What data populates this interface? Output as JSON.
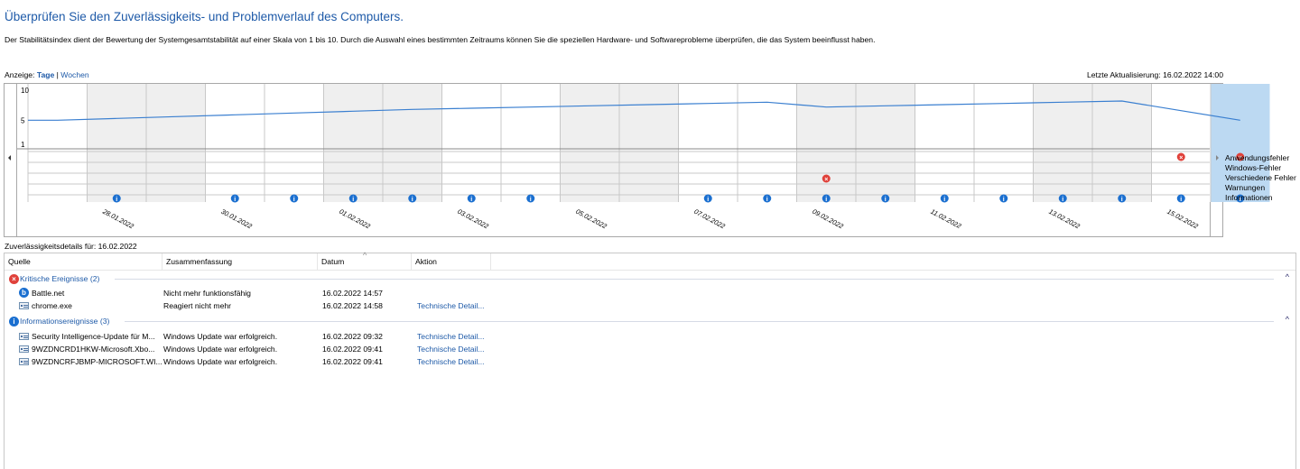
{
  "header": {
    "title": "Überprüfen Sie den Zuverlässigkeits- und Problemverlauf des Computers.",
    "description": "Der Stabilitätsindex dient der Bewertung der Systemgesamtstabilität auf einer Skala von 1 bis 10. Durch die Auswahl eines bestimmten Zeitraums können Sie die speziellen Hardware- und Softwareprobleme überprüfen, die das System beeinflusst haben.",
    "view_label": "Anzeige:",
    "view_days": "Tage",
    "view_sep": "|",
    "view_weeks": "Wochen",
    "last_update": "Letzte Aktualisierung: 16.02.2022 14:00"
  },
  "chart": {
    "y_ticks": [
      "10",
      "5",
      "1"
    ],
    "legend": [
      "Anwendungsfehler",
      "Windows-Fehler",
      "Verschiedene Fehler",
      "Warnungen",
      "Informationen"
    ],
    "date_labels": [
      "28.01.2022",
      "30.01.2022",
      "01.02.2022",
      "03.02.2022",
      "05.02.2022",
      "07.02.2022",
      "09.02.2022",
      "11.02.2022",
      "13.02.2022",
      "15.02.2022"
    ],
    "selected_day": "16.02.2022",
    "colors": {
      "line": "#3a7fd0",
      "selected": "#bcd9f2",
      "alt": "#efefef",
      "error": "#e0413a",
      "info": "#1a6fd0"
    },
    "chart_data": {
      "type": "line",
      "x": [
        "27.01.2022",
        "28.01.2022",
        "29.01.2022",
        "30.01.2022",
        "31.01.2022",
        "01.02.2022",
        "02.02.2022",
        "03.02.2022",
        "04.02.2022",
        "05.02.2022",
        "06.02.2022",
        "07.02.2022",
        "08.02.2022",
        "09.02.2022",
        "10.02.2022",
        "11.02.2022",
        "12.02.2022",
        "13.02.2022",
        "14.02.2022",
        "15.02.2022",
        "16.02.2022"
      ],
      "series": [
        {
          "values": [
            5.0,
            5.3,
            5.6,
            5.9,
            6.2,
            6.5,
            6.8,
            7.0,
            7.2,
            7.4,
            7.6,
            7.8,
            8.0,
            7.2,
            7.4,
            7.6,
            7.8,
            8.0,
            8.2,
            6.6,
            5.0
          ]
        }
      ],
      "ylim": [
        1,
        10
      ],
      "markers": {
        "Anwendungsfehler": [
          "15.02.2022",
          "16.02.2022"
        ],
        "Verschiedene Fehler": [
          "09.02.2022"
        ],
        "Informationen": [
          "28.01.2022",
          "30.01.2022",
          "31.01.2022",
          "01.02.2022",
          "02.02.2022",
          "03.02.2022",
          "04.02.2022",
          "07.02.2022",
          "08.02.2022",
          "09.02.2022",
          "10.02.2022",
          "11.02.2022",
          "12.02.2022",
          "13.02.2022",
          "14.02.2022",
          "15.02.2022",
          "16.02.2022"
        ]
      }
    }
  },
  "details": {
    "label": "Zuverlässigkeitsdetails für: 16.02.2022",
    "columns": [
      "Quelle",
      "Zusammenfassung",
      "Datum",
      "Aktion"
    ],
    "groups": [
      {
        "title": "Kritische Ereignisse (2)",
        "rows": [
          {
            "source": "Battle.net",
            "summary": "Nicht mehr funktionsfähig",
            "date": "16.02.2022 14:57",
            "action": ""
          },
          {
            "source": "chrome.exe",
            "summary": "Reagiert nicht mehr",
            "date": "16.02.2022 14:58",
            "action": "Technische Detail..."
          }
        ]
      },
      {
        "title": "Informationsereignisse (3)",
        "rows": [
          {
            "source": "Security Intelligence-Update für M...",
            "summary": "Windows Update war erfolgreich.",
            "date": "16.02.2022 09:32",
            "action": "Technische Detail..."
          },
          {
            "source": "9WZDNCRD1HKW-Microsoft.Xbo...",
            "summary": "Windows Update war erfolgreich.",
            "date": "16.02.2022 09:41",
            "action": "Technische Detail..."
          },
          {
            "source": "9WZDNCRFJBMP-MICROSOFT.WI...",
            "summary": "Windows Update war erfolgreich.",
            "date": "16.02.2022 09:41",
            "action": "Technische Detail..."
          }
        ]
      }
    ]
  }
}
